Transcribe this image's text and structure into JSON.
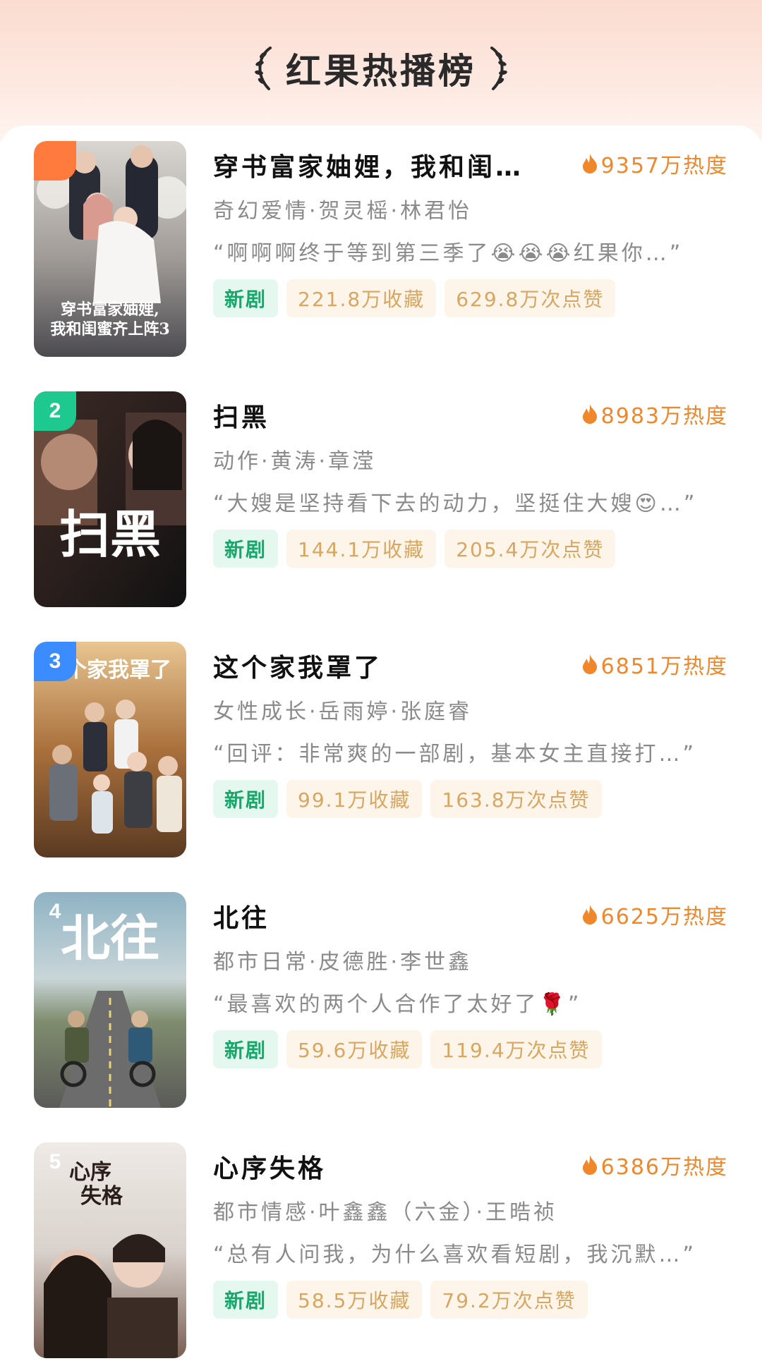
{
  "page": {
    "title": "红果热播榜"
  },
  "colors": {
    "heat": "#f0882b",
    "new_tag_text": "#16a86a",
    "new_tag_bg": "#e4f8ef",
    "stat_tag_text": "#d8a660",
    "stat_tag_bg": "#fdf5ea",
    "rank1": "#ff7a3d",
    "rank2": "#1ec98f",
    "rank3": "#3b8cff"
  },
  "items": [
    {
      "rank": "",
      "title": "穿书富家妯娌，我和闺…",
      "heat": "9357万热度",
      "meta": "奇幻爱情·贺灵榣·林君怡",
      "quote": "“啊啊啊终于等到第三季了😭😭😭红果你…”",
      "tags": {
        "new": "新剧",
        "collect": "221.8万收藏",
        "likes": "629.8万次点赞"
      },
      "poster_text": "穿书富家妯娌，我和闺蜜齐上阵3"
    },
    {
      "rank": "2",
      "title": "扫黑",
      "heat": "8983万热度",
      "meta": "动作·黄涛·章滢",
      "quote": "“大嫂是坚持看下去的动力，坚挺住大嫂😍…”",
      "tags": {
        "new": "新剧",
        "collect": "144.1万收藏",
        "likes": "205.4万次点赞"
      },
      "poster_text": "扫黑"
    },
    {
      "rank": "3",
      "title": "这个家我罩了",
      "heat": "6851万热度",
      "meta": "女性成长·岳雨婷·张庭睿",
      "quote": "“回评：非常爽的一部剧，基本女主直接打…”",
      "tags": {
        "new": "新剧",
        "collect": "99.1万收藏",
        "likes": "163.8万次点赞"
      },
      "poster_text": "这个家我罩了"
    },
    {
      "rank": "4",
      "title": "北往",
      "heat": "6625万热度",
      "meta": "都市日常·皮德胜·李世鑫",
      "quote": "“最喜欢的两个人合作了太好了🌹”",
      "tags": {
        "new": "新剧",
        "collect": "59.6万收藏",
        "likes": "119.4万次点赞"
      },
      "poster_text": "北往"
    },
    {
      "rank": "5",
      "title": "心序失格",
      "heat": "6386万热度",
      "meta": "都市情感·叶鑫鑫（六金）·王晧祯",
      "quote": "“总有人问我，为什么喜欢看短剧，我沉默…”",
      "tags": {
        "new": "新剧",
        "collect": "58.5万收藏",
        "likes": "79.2万次点赞"
      },
      "poster_text": "心序失格"
    }
  ]
}
